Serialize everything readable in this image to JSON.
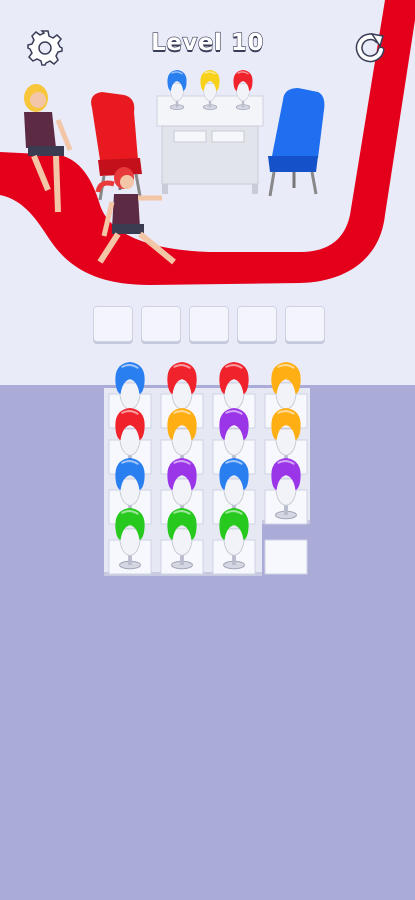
{
  "level_label": "Level 10",
  "icons": {
    "settings": "gear-icon",
    "restart": "restart-arrow-icon"
  },
  "colors": {
    "floor_upper": "#e9ebf8",
    "floor_lower": "#aaabd6",
    "runway": "#e4001a",
    "blue": "#2a7ff0",
    "red": "#f0222b",
    "yellow": "#f8d21a",
    "orange": "#ffae14",
    "purple": "#9b35e8",
    "green": "#27c91f"
  },
  "display_wigs": [
    "blue",
    "yellow",
    "red"
  ],
  "selection_slots": 5,
  "wig_grid": [
    [
      "blue",
      "red",
      "blue",
      "green"
    ],
    [
      "red",
      "orange",
      "purple",
      "green"
    ],
    [
      "red",
      "purple",
      "blue",
      "green"
    ],
    [
      "orange",
      "orange",
      "purple",
      null
    ]
  ]
}
